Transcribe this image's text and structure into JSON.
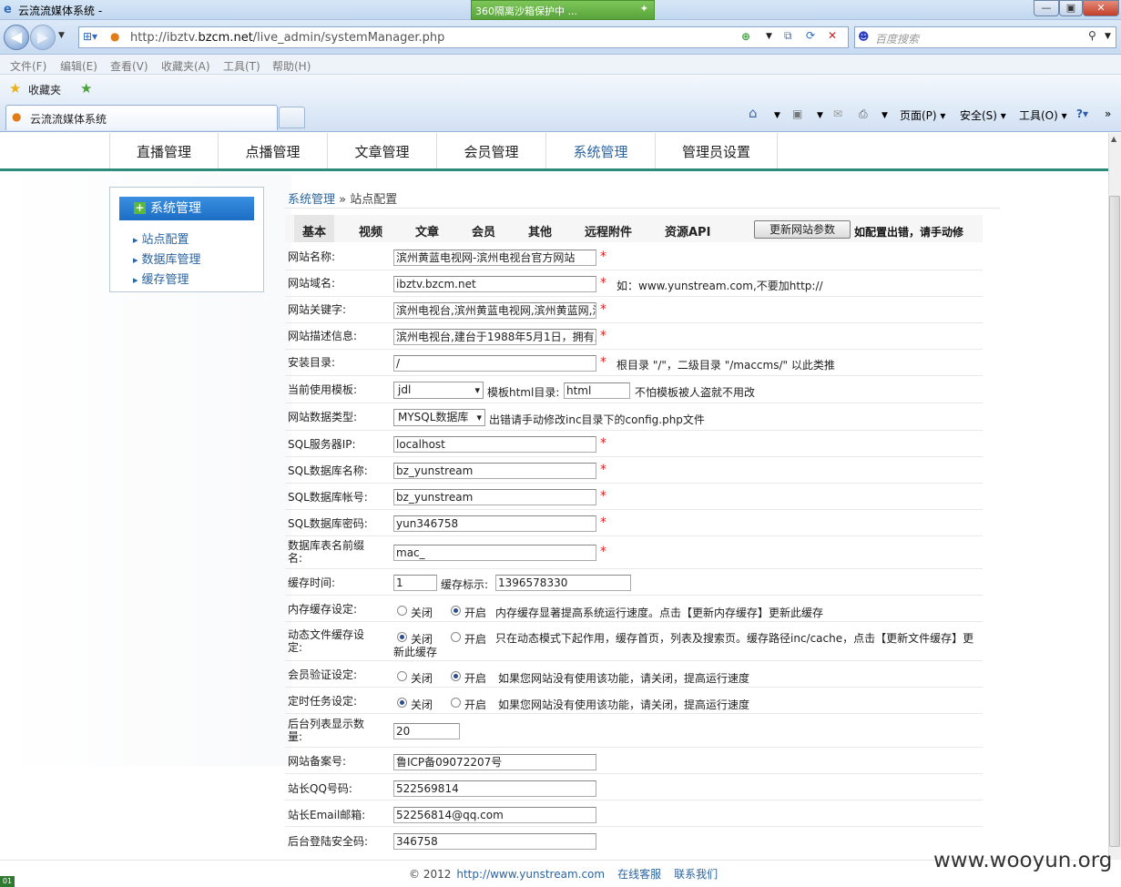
{
  "window": {
    "title": "云流流媒体系统 -",
    "sandbox": "360隔离沙箱保护中 ..."
  },
  "address": {
    "prefix": "http://ibztv.",
    "domain": "bzcm.net",
    "path": "/live_admin/systemManager.php"
  },
  "search": {
    "placeholder": "百度搜索"
  },
  "menu": [
    "文件(F)",
    "编辑(E)",
    "查看(V)",
    "收藏夹(A)",
    "工具(T)",
    "帮助(H)"
  ],
  "favorites": {
    "label": "收藏夹"
  },
  "tab": {
    "title": "云流流媒体系统"
  },
  "commands": {
    "page": "页面(P)",
    "safety": "安全(S)",
    "tools": "工具(O)"
  },
  "site_nav": [
    "直播管理",
    "点播管理",
    "文章管理",
    "会员管理",
    "系统管理",
    "管理员设置"
  ],
  "sidebar": {
    "title": "系统管理",
    "items": [
      "站点配置",
      "数据库管理",
      "缓存管理"
    ]
  },
  "breadcrumb": {
    "parent": "系统管理",
    "sep": " » ",
    "current": "站点配置"
  },
  "subtabs": [
    "基本",
    "视频",
    "文章",
    "会员",
    "其他",
    "远程附件",
    "资源API"
  ],
  "update_button": "更新网站参数",
  "update_note": "如配置出错，请手动修",
  "form": {
    "site_name": {
      "label": "网站名称:",
      "value": "滨州黄蓝电视网-滨州电视台官方网站"
    },
    "site_domain": {
      "label": "网站域名:",
      "value": "ibztv.bzcm.net",
      "note": "如：www.yunstream.com,不要加http://"
    },
    "keywords": {
      "label": "网站关键字:",
      "value": "滨州电视台,滨州黄蓝电视网,滨州黄蓝网,滨"
    },
    "description": {
      "label": "网站描述信息:",
      "value": "滨州电视台,建台于1988年5月1日，拥有三"
    },
    "install_dir": {
      "label": "安装目录:",
      "value": "/",
      "note": "根目录 \"/\"，二级目录 \"/maccms/\" 以此类推"
    },
    "template": {
      "label": "当前使用模板:",
      "value": "jdl",
      "dir_label": "模板html目录:",
      "dir_value": "html",
      "dir_note": "不怕模板被人盗就不用改"
    },
    "db_type": {
      "label": "网站数据类型:",
      "value": "MYSQL数据库",
      "note": "出错请手动修改inc目录下的config.php文件"
    },
    "sql_ip": {
      "label": "SQL服务器IP:",
      "value": "localhost"
    },
    "sql_db": {
      "label": "SQL数据库名称:",
      "value": "bz_yunstream"
    },
    "sql_user": {
      "label": "SQL数据库帐号:",
      "value": "bz_yunstream"
    },
    "sql_pass": {
      "label": "SQL数据库密码:",
      "value": "yun346758"
    },
    "table_prefix": {
      "label": "数据库表名前缀名:",
      "value": "mac_"
    },
    "cache_time": {
      "label": "缓存时间:",
      "value": "1",
      "flag_label": "缓存标示:",
      "flag_value": "1396578330"
    },
    "mem_cache": {
      "label": "内存缓存设定:",
      "off": "关闭",
      "on": "开启",
      "selected": "on",
      "note": "内存缓存显著提高系统运行速度。点击【更新内存缓存】更新此缓存"
    },
    "file_cache": {
      "label": "动态文件缓存设定:",
      "off": "关闭",
      "on": "开启",
      "selected": "off",
      "note": "只在动态模式下起作用，缓存首页，列表及搜索页。缓存路径inc/cache，点击【更新文件缓存】更",
      "note2": "新此缓存"
    },
    "member_verify": {
      "label": "会员验证设定:",
      "off": "关闭",
      "on": "开启",
      "selected": "on",
      "note": "如果您网站没有使用该功能，请关闭，提高运行速度"
    },
    "cron": {
      "label": "定时任务设定:",
      "off": "关闭",
      "on": "开启",
      "selected": "off",
      "note": "如果您网站没有使用该功能，请关闭，提高运行速度"
    },
    "list_count": {
      "label": "后台列表显示数量:",
      "value": "20"
    },
    "icp": {
      "label": "网站备案号:",
      "value": "鲁ICP备09072207号"
    },
    "qq": {
      "label": "站长QQ号码:",
      "value": "522569814"
    },
    "email": {
      "label": "站长Email邮箱:",
      "value": "52256814@qq.com"
    },
    "login_code": {
      "label": "后台登陆安全码:",
      "value": "346758"
    }
  },
  "footer": {
    "copy": "© 2012",
    "link": "http://www.yunstream.com",
    "service": "在线客服",
    "contact": "联系我们"
  },
  "watermark": "www.wooyun.org"
}
